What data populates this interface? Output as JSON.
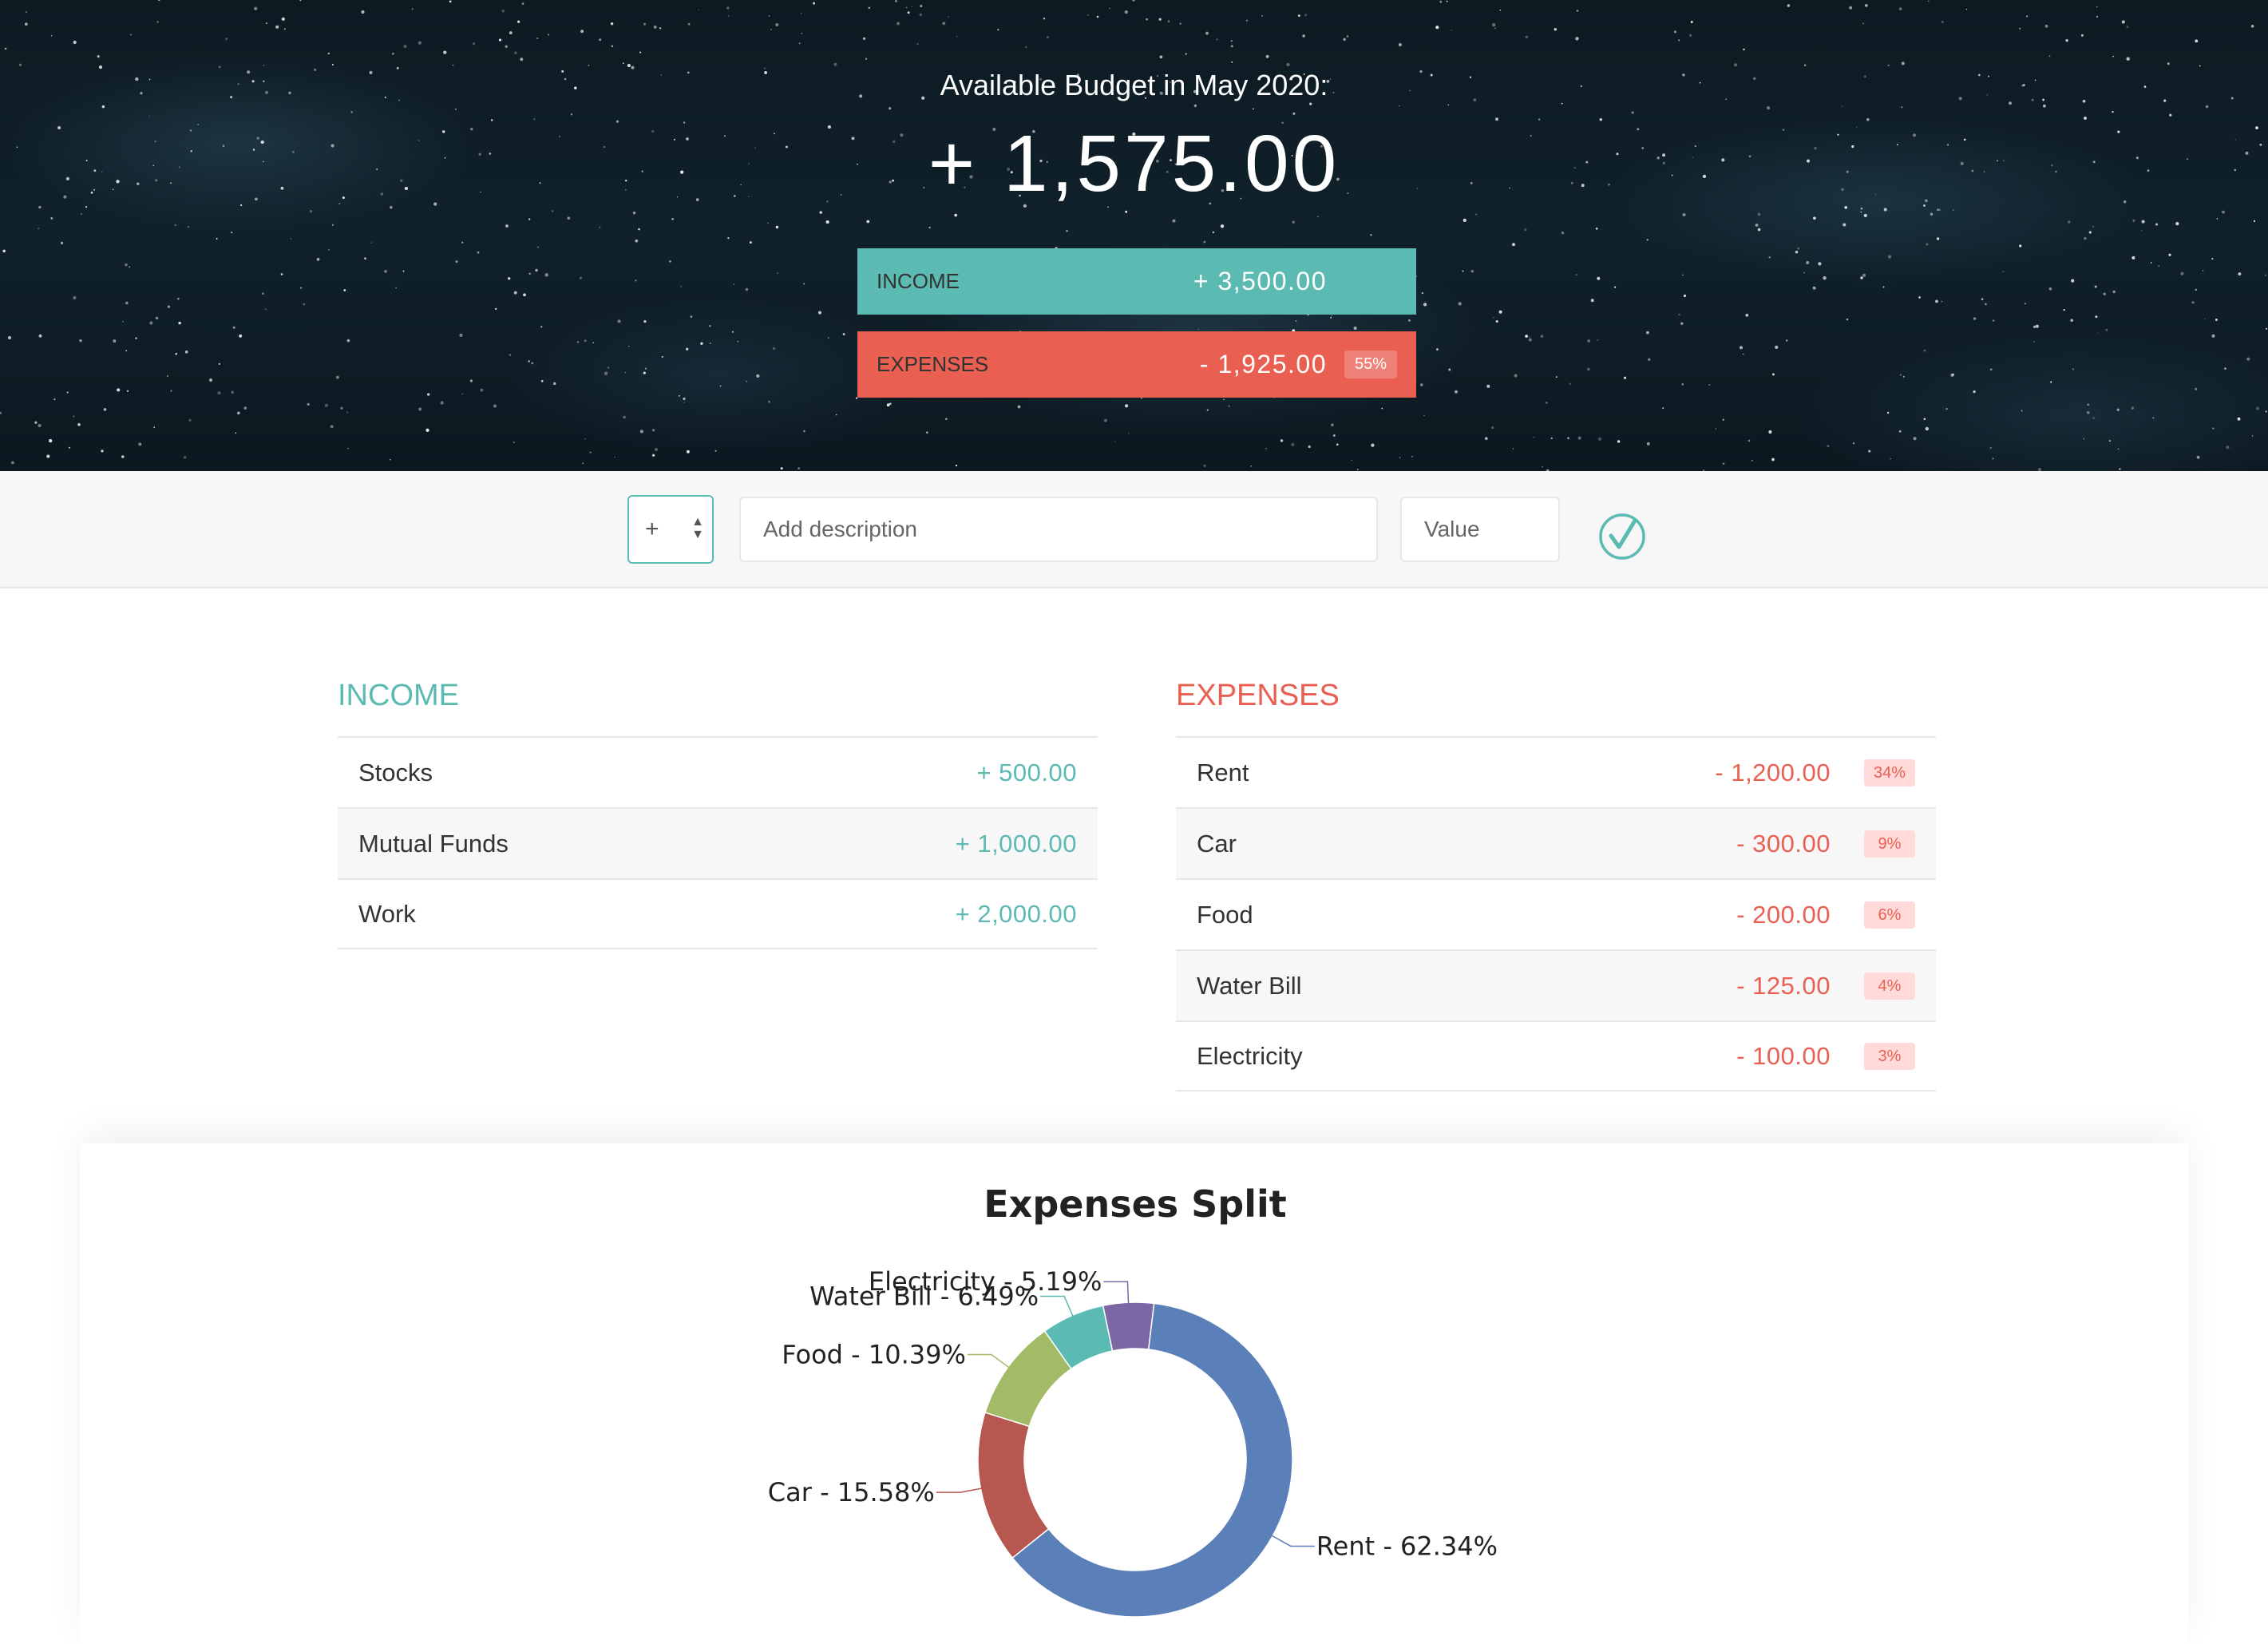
{
  "header": {
    "title": "Available Budget in May 2020:",
    "budget": "+ 1,575.00",
    "income_label": "Income",
    "income_value": "+ 3,500.00",
    "expenses_label": "Expenses",
    "expenses_value": "- 1,925.00",
    "expenses_percent": "55%"
  },
  "add_form": {
    "type_value": "+",
    "description_placeholder": "Add description",
    "value_placeholder": "Value",
    "submit_icon": "check-circle-icon"
  },
  "income": {
    "title": "Income",
    "items": [
      {
        "description": "Stocks",
        "value": "+ 500.00"
      },
      {
        "description": "Mutual Funds",
        "value": "+ 1,000.00"
      },
      {
        "description": "Work",
        "value": "+ 2,000.00"
      }
    ]
  },
  "expenses": {
    "title": "Expenses",
    "items": [
      {
        "description": "Rent",
        "value": "- 1,200.00",
        "percent": "34%"
      },
      {
        "description": "Car",
        "value": "- 300.00",
        "percent": "9%"
      },
      {
        "description": "Food",
        "value": "- 200.00",
        "percent": "6%"
      },
      {
        "description": "Water Bill",
        "value": "- 125.00",
        "percent": "4%"
      },
      {
        "description": "Electricity",
        "value": "- 100.00",
        "percent": "3%"
      }
    ]
  },
  "colors": {
    "income": "#5bbab2",
    "expenses": "#e95f52"
  },
  "chart_data": {
    "type": "pie",
    "title": "Expenses Split",
    "donut": true,
    "categories": [
      "Rent",
      "Car",
      "Food",
      "Water Bill",
      "Electricity"
    ],
    "values": [
      62.34,
      15.58,
      10.39,
      6.49,
      5.19
    ],
    "labels": [
      "Rent - 62.34%",
      "Car - 15.58%",
      "Food - 10.39%",
      "Water Bill - 6.49%",
      "Electricity - 5.19%"
    ],
    "colors": [
      "#5b7fb8",
      "#b65750",
      "#a3bb67",
      "#5bbab2",
      "#7c66a3"
    ]
  }
}
